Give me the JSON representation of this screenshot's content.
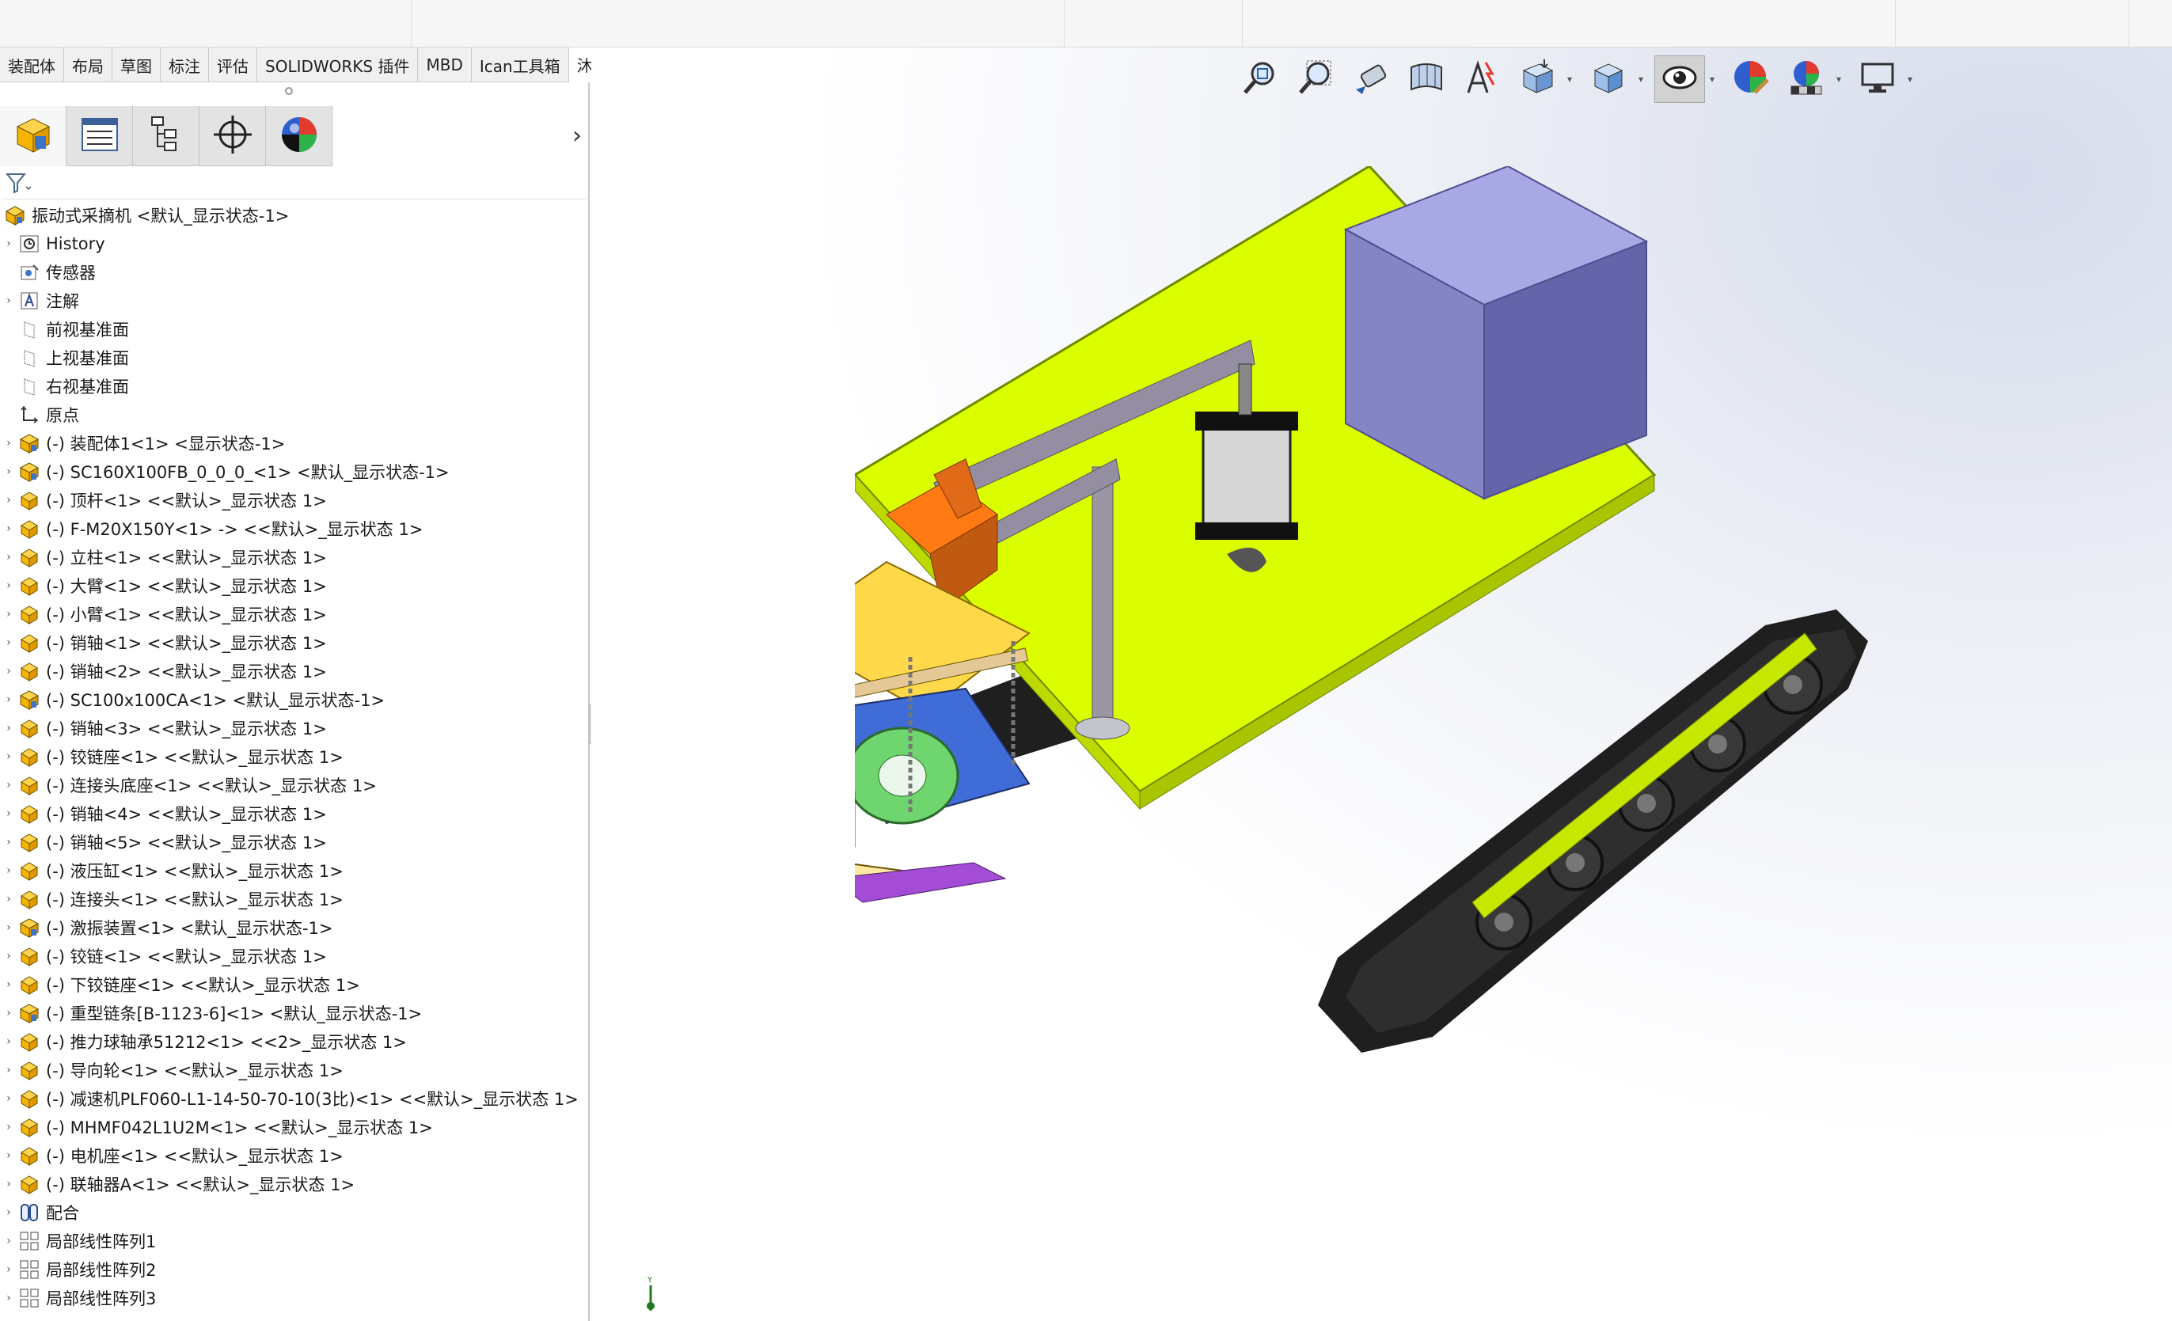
{
  "tabs": [
    "装配体",
    "布局",
    "草图",
    "标注",
    "评估",
    "SOLIDWORKS 插件",
    "MBD",
    "Ican工具箱",
    "沐风工具箱"
  ],
  "active_tab": "沐风工具箱",
  "manager_tabs": [
    "feature-manager-icon",
    "property-manager-icon",
    "configuration-manager-icon",
    "dimxpert-manager-icon",
    "display-manager-icon"
  ],
  "tree": {
    "root": "振动式采摘机 <默认_显示状态-1>",
    "items": [
      {
        "label": "History",
        "icon": "history-icon",
        "exp": true
      },
      {
        "label": "传感器",
        "icon": "sensor-icon",
        "exp": false
      },
      {
        "label": "注解",
        "icon": "annotation-icon",
        "exp": true
      },
      {
        "label": "前视基准面",
        "icon": "plane-icon",
        "exp": false
      },
      {
        "label": "上视基准面",
        "icon": "plane-icon",
        "exp": false
      },
      {
        "label": "右视基准面",
        "icon": "plane-icon",
        "exp": false
      },
      {
        "label": "原点",
        "icon": "origin-icon",
        "exp": false
      },
      {
        "label": "(-) 装配体1<1> <显示状态-1>",
        "icon": "assembly-icon",
        "exp": true
      },
      {
        "label": "(-) SC160X100FB_0_0_0_<1> <默认_显示状态-1>",
        "icon": "assembly-icon",
        "exp": true
      },
      {
        "label": "(-) 顶杆<1> <<默认>_显示状态 1>",
        "icon": "part-icon",
        "exp": true
      },
      {
        "label": "(-) F-M20X150Y<1> -> <<默认>_显示状态 1>",
        "icon": "part-icon",
        "exp": true
      },
      {
        "label": "(-) 立柱<1> <<默认>_显示状态 1>",
        "icon": "part-icon",
        "exp": true
      },
      {
        "label": "(-) 大臂<1> <<默认>_显示状态 1>",
        "icon": "part-icon",
        "exp": true
      },
      {
        "label": "(-) 小臂<1> <<默认>_显示状态 1>",
        "icon": "part-icon",
        "exp": true
      },
      {
        "label": "(-) 销轴<1> <<默认>_显示状态 1>",
        "icon": "part-icon",
        "exp": true
      },
      {
        "label": "(-) 销轴<2> <<默认>_显示状态 1>",
        "icon": "part-icon",
        "exp": true
      },
      {
        "label": "(-) SC100x100CA<1> <默认_显示状态-1>",
        "icon": "assembly-icon",
        "exp": true
      },
      {
        "label": "(-) 销轴<3> <<默认>_显示状态 1>",
        "icon": "part-icon",
        "exp": true
      },
      {
        "label": "(-) 铰链座<1> <<默认>_显示状态 1>",
        "icon": "part-icon",
        "exp": true
      },
      {
        "label": "(-) 连接头底座<1> <<默认>_显示状态 1>",
        "icon": "part-icon",
        "exp": true
      },
      {
        "label": "(-) 销轴<4> <<默认>_显示状态 1>",
        "icon": "part-icon",
        "exp": true
      },
      {
        "label": "(-) 销轴<5> <<默认>_显示状态 1>",
        "icon": "part-icon",
        "exp": true
      },
      {
        "label": "(-) 液压缸<1> <<默认>_显示状态 1>",
        "icon": "part-icon",
        "exp": true
      },
      {
        "label": "(-) 连接头<1> <<默认>_显示状态 1>",
        "icon": "part-icon",
        "exp": true
      },
      {
        "label": "(-) 激振装置<1> <默认_显示状态-1>",
        "icon": "assembly-icon",
        "exp": true
      },
      {
        "label": "(-) 铰链<1> <<默认>_显示状态 1>",
        "icon": "part-icon",
        "exp": true
      },
      {
        "label": "(-) 下铰链座<1> <<默认>_显示状态 1>",
        "icon": "part-icon",
        "exp": true
      },
      {
        "label": "(-) 重型链条[B-1123-6]<1> <默认_显示状态-1>",
        "icon": "assembly-icon",
        "exp": true
      },
      {
        "label": "(-) 推力球轴承51212<1> <<2>_显示状态 1>",
        "icon": "part-icon",
        "exp": true
      },
      {
        "label": "(-) 导向轮<1> <<默认>_显示状态 1>",
        "icon": "part-icon",
        "exp": true
      },
      {
        "label": "(-) 减速机PLF060-L1-14-50-70-10(3比)<1> <<默认>_显示状态 1>",
        "icon": "part-icon",
        "exp": true
      },
      {
        "label": "(-) MHMF042L1U2M<1> <<默认>_显示状态 1>",
        "icon": "part-icon",
        "exp": true
      },
      {
        "label": "(-) 电机座<1> <<默认>_显示状态 1>",
        "icon": "part-icon",
        "exp": true
      },
      {
        "label": "(-) 联轴器A<1> <<默认>_显示状态 1>",
        "icon": "part-icon",
        "exp": true
      },
      {
        "label": "配合",
        "icon": "mates-icon",
        "exp": true
      },
      {
        "label": "局部线性阵列1",
        "icon": "pattern-icon",
        "exp": true
      },
      {
        "label": "局部线性阵列2",
        "icon": "pattern-icon",
        "exp": true
      },
      {
        "label": "局部线性阵列3",
        "icon": "pattern-icon",
        "exp": true
      }
    ]
  },
  "heads_up_toolbar": [
    {
      "name": "zoom-to-fit-icon",
      "dropdown": false
    },
    {
      "name": "zoom-to-area-icon",
      "dropdown": false
    },
    {
      "name": "previous-view-icon",
      "dropdown": false
    },
    {
      "name": "section-view-icon",
      "dropdown": false
    },
    {
      "name": "dynamic-annotation-icon",
      "dropdown": false
    },
    {
      "name": "view-orientation-icon",
      "dropdown": true
    },
    {
      "name": "display-style-icon",
      "dropdown": true
    },
    {
      "name": "hide-show-items-icon",
      "dropdown": true,
      "pressed": true
    },
    {
      "name": "edit-appearance-icon",
      "dropdown": false
    },
    {
      "name": "apply-scene-icon",
      "dropdown": true
    },
    {
      "name": "view-settings-icon",
      "dropdown": true
    }
  ],
  "triad_label": "Y",
  "colors": {
    "platform": "#dcff00",
    "box": "#8c8ccc",
    "track": "#262626",
    "accent_orange": "#ff7a12"
  }
}
